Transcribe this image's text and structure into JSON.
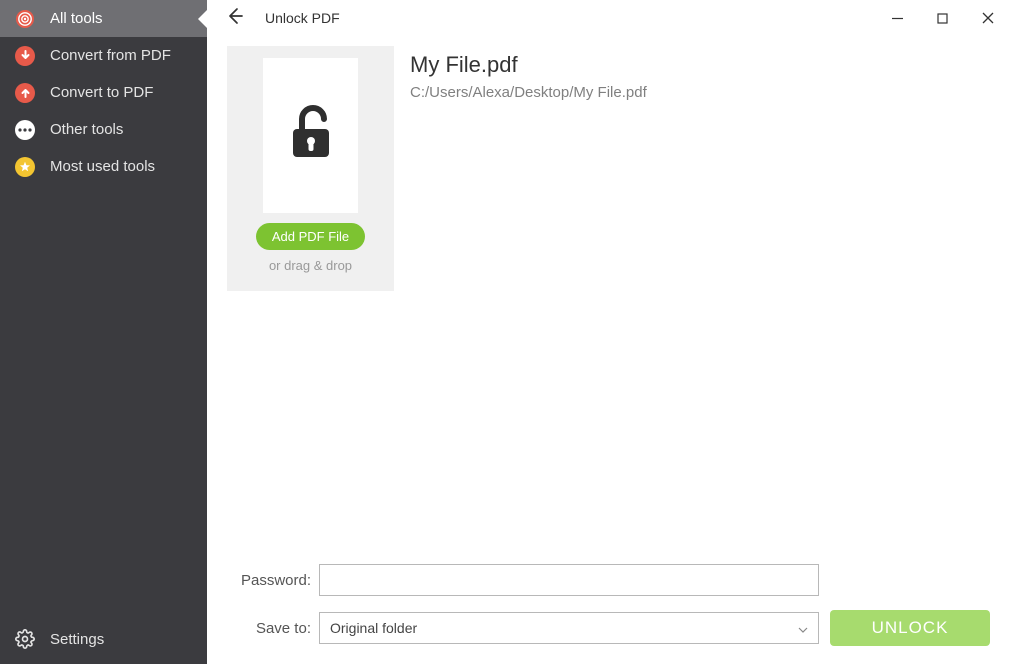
{
  "sidebar": {
    "items": [
      {
        "label": "All tools"
      },
      {
        "label": "Convert from PDF"
      },
      {
        "label": "Convert to PDF"
      },
      {
        "label": "Other tools"
      },
      {
        "label": "Most used tools"
      }
    ],
    "settings_label": "Settings"
  },
  "titlebar": {
    "page_title": "Unlock PDF"
  },
  "content": {
    "file": {
      "name": "My File.pdf",
      "path": "C:/Users/Alexa/Desktop/My File.pdf"
    },
    "add_button": "Add PDF File",
    "drag_hint": "or drag & drop"
  },
  "form": {
    "password_label": "Password:",
    "password_value": "",
    "save_to_label": "Save to:",
    "save_to_value": "Original folder",
    "unlock_button": "UNLOCK"
  }
}
